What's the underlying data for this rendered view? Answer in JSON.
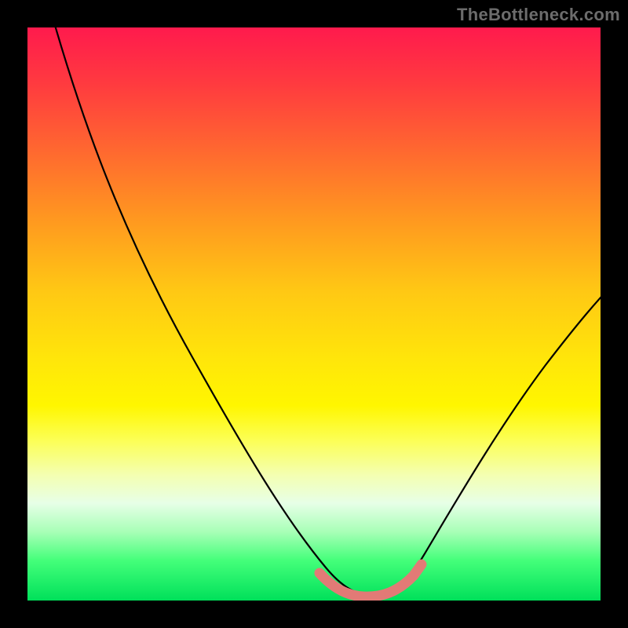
{
  "watermark": "TheBottleneck.com",
  "colors": {
    "frame": "#000000",
    "curve": "#000000",
    "highlight": "#e27a76",
    "gradient_top": "#ff1a4d",
    "gradient_bottom": "#00e05a"
  },
  "chart_data": {
    "type": "line",
    "title": "",
    "xlabel": "",
    "ylabel": "",
    "xlim": [
      0,
      100
    ],
    "ylim": [
      0,
      100
    ],
    "series": [
      {
        "name": "bottleneck-curve",
        "x": [
          0,
          5,
          10,
          15,
          20,
          25,
          30,
          35,
          40,
          45,
          50,
          53,
          56,
          60,
          63,
          65,
          70,
          75,
          80,
          85,
          90,
          95,
          100
        ],
        "values": [
          100,
          94,
          87,
          80,
          72,
          63,
          54,
          45,
          35,
          24,
          12,
          4,
          1,
          0,
          1,
          4,
          13,
          23,
          32,
          40,
          47,
          53,
          58
        ]
      }
    ],
    "highlight_region": {
      "name": "optimal-zone",
      "x": [
        50,
        53,
        56,
        60,
        63,
        65
      ],
      "values": [
        12,
        4,
        1,
        0,
        1,
        4
      ]
    },
    "annotations": []
  }
}
